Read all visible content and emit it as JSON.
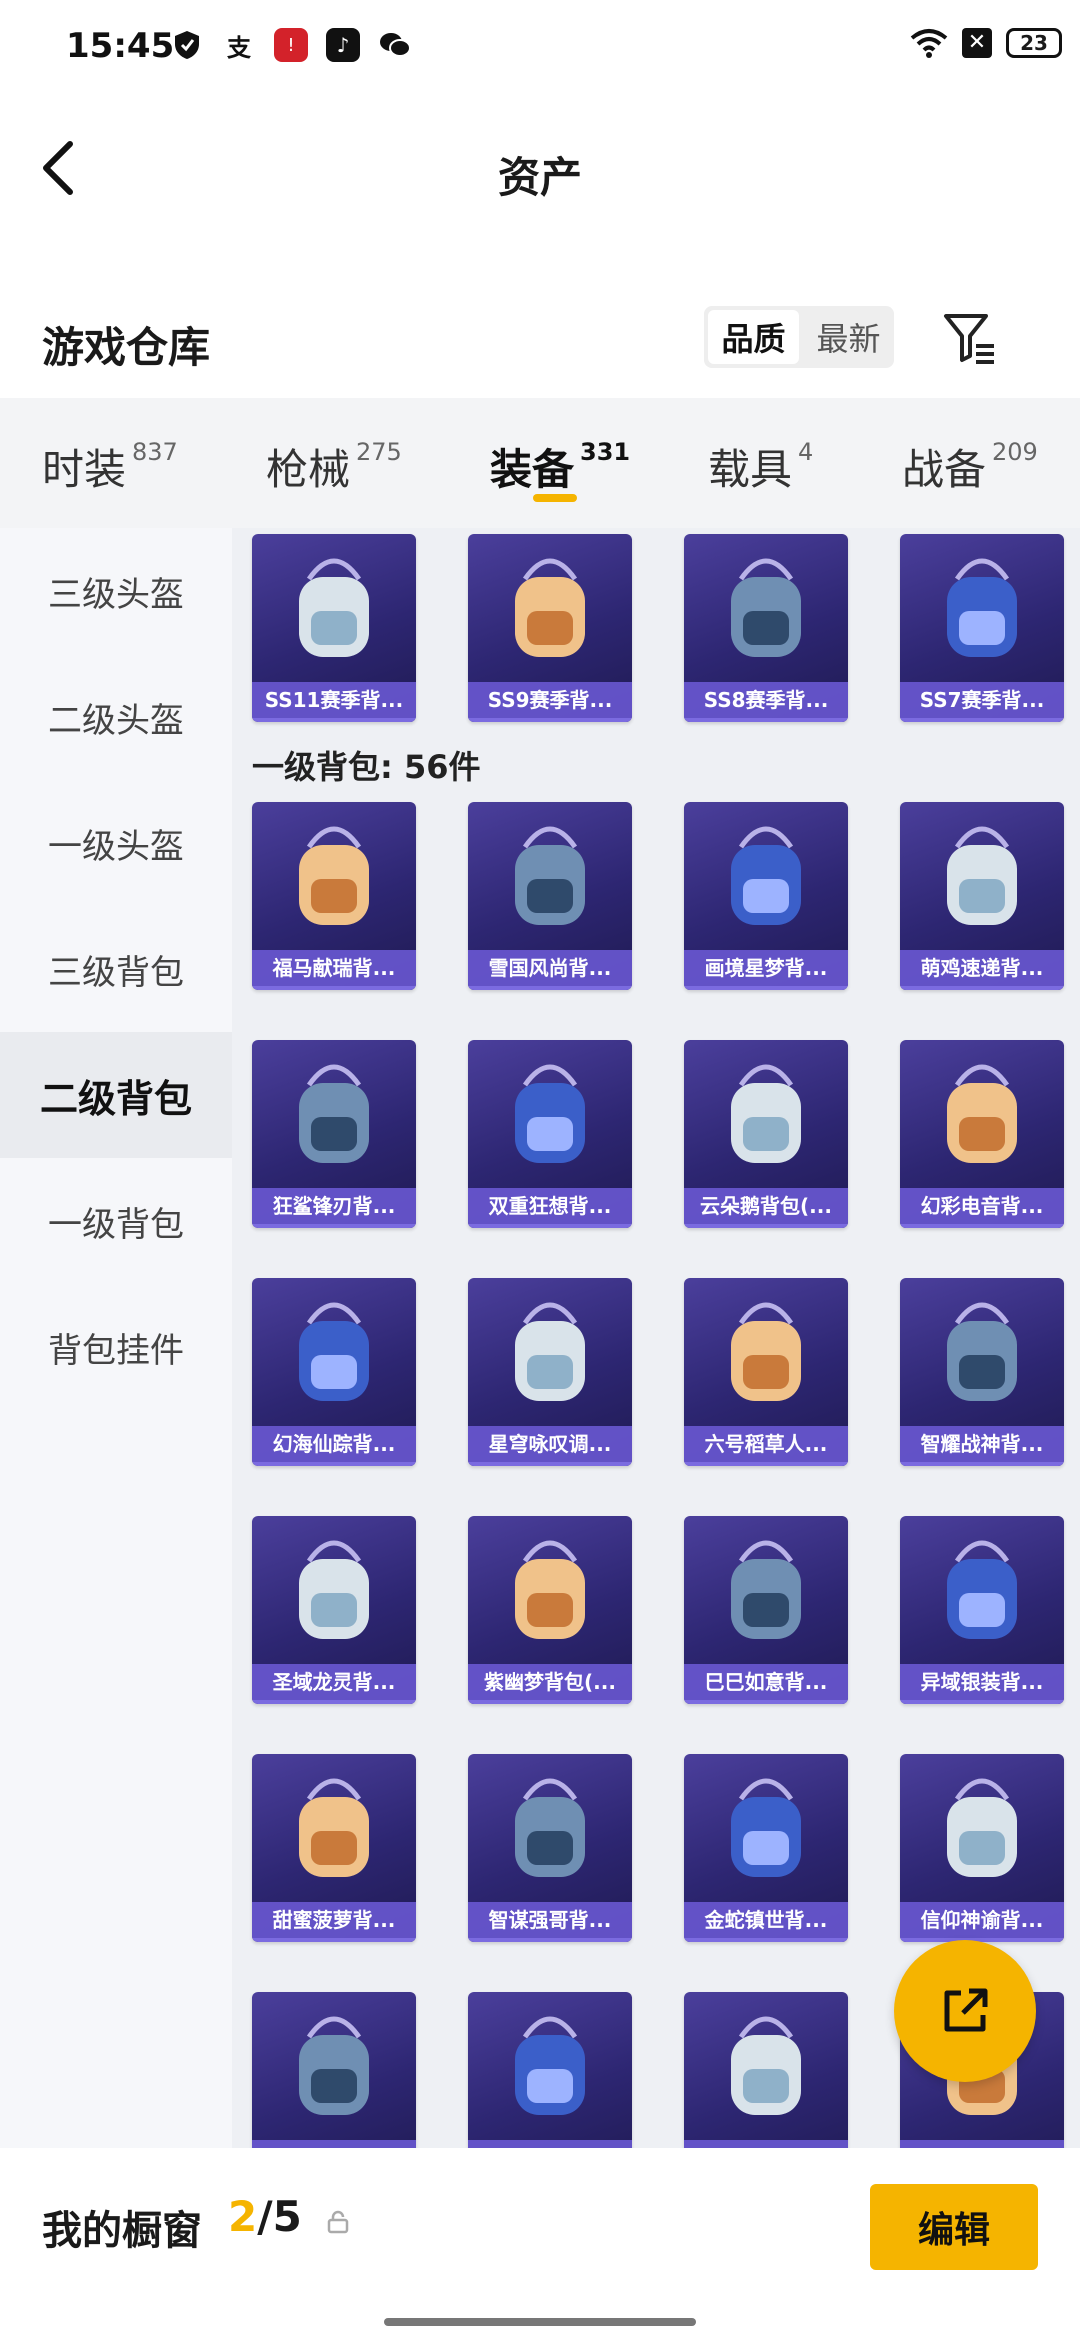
{
  "status_bar": {
    "time": "15:45",
    "battery": "23",
    "icons": [
      "shield-icon",
      "alipay-icon",
      "red-notification-icon",
      "tiktok-icon",
      "wechat-icon"
    ]
  },
  "header": {
    "title": "资产"
  },
  "warehouse": {
    "title": "游戏仓库",
    "sort_options": [
      "品质",
      "最新"
    ],
    "selected_sort": "品质"
  },
  "tabs": [
    {
      "label": "时装",
      "count": "837"
    },
    {
      "label": "枪械",
      "count": "275"
    },
    {
      "label": "装备",
      "count": "331",
      "active": true
    },
    {
      "label": "载具",
      "count": "4"
    },
    {
      "label": "战备",
      "count": "209"
    }
  ],
  "sidebar": {
    "items": [
      {
        "label": "三级头盔"
      },
      {
        "label": "二级头盔"
      },
      {
        "label": "一级头盔"
      },
      {
        "label": "三级背包"
      },
      {
        "label": "二级背包",
        "active": true
      },
      {
        "label": "一级背包"
      },
      {
        "label": "背包挂件"
      }
    ]
  },
  "content": {
    "top_row": [
      "SS11赛季背...",
      "SS9赛季背...",
      "SS8赛季背...",
      "SS7赛季背..."
    ],
    "group_label": "一级背包: 56件",
    "rows": [
      [
        "福马献瑞背...",
        "雪国风尚背...",
        "画境星梦背...",
        "萌鸡速递背..."
      ],
      [
        "狂鲨锋刃背...",
        "双重狂想背...",
        "云朵鹅背包(...",
        "幻彩电音背..."
      ],
      [
        "幻海仙踪背...",
        "星穹咏叹调...",
        "六号稻草人...",
        "智耀战神背..."
      ],
      [
        "圣域龙灵背...",
        "紫幽梦背包(...",
        "巳巳如意背...",
        "异域银装背..."
      ],
      [
        "甜蜜菠萝背...",
        "智谋强哥背...",
        "金蛇镇世背...",
        "信仰神谕背..."
      ],
      [
        "",
        "",
        "",
        ""
      ]
    ]
  },
  "bottom_bar": {
    "title": "我的橱窗",
    "current": "2",
    "total": "/5",
    "edit_label": "编辑"
  },
  "colors": {
    "accent": "#f5b400",
    "card_label": "#6958d2"
  }
}
